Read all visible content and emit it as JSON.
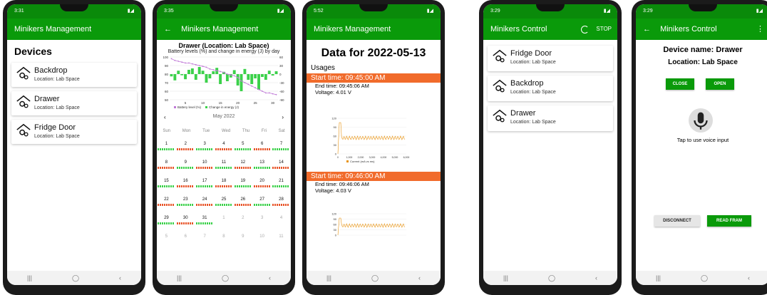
{
  "phones": {
    "p1": {
      "status": {
        "time": "3:31",
        "sys": "▮◢"
      },
      "title": "Minikers Management",
      "heading": "Devices",
      "devices": [
        {
          "name": "Backdrop",
          "location": "Location: Lab Space"
        },
        {
          "name": "Drawer",
          "location": "Location: Lab Space"
        },
        {
          "name": "Fridge Door",
          "location": "Location: Lab Space"
        }
      ]
    },
    "p2": {
      "status": {
        "time": "3:35",
        "sys": "▮◢"
      },
      "title": "Minikers Management",
      "chart_title": "Drawer (Location: Lab Space)",
      "chart_subtitle": "Battery levels (%) and change in energy (J) by day",
      "legend_battery": "Battery level (%)",
      "legend_energy": "Change in energy (J)",
      "month": "May 2022",
      "dows": [
        "Sun",
        "Mon",
        "Tue",
        "Wed",
        "Thu",
        "Fri",
        "Sat"
      ],
      "weeks": [
        [
          "1",
          "2",
          "3",
          "4",
          "5",
          "6",
          "7"
        ],
        [
          "8",
          "9",
          "10",
          "11",
          "12",
          "13",
          "14"
        ],
        [
          "15",
          "16",
          "17",
          "18",
          "19",
          "20",
          "21"
        ],
        [
          "22",
          "23",
          "24",
          "25",
          "26",
          "27",
          "28"
        ],
        [
          "29",
          "30",
          "31",
          "1",
          "2",
          "3",
          "4"
        ],
        [
          "5",
          "6",
          "7",
          "8",
          "9",
          "10",
          "11"
        ]
      ]
    },
    "p3": {
      "status": {
        "time": "5:52",
        "sys": "▮◢"
      },
      "title": "Minikers Management",
      "big": "Data for 2022-05-13",
      "usages": "Usages",
      "entries": [
        {
          "start": "Start time: 09:45:00 AM",
          "end": "End time: 09:45:06 AM",
          "voltage": "Voltage: 4.01 V"
        },
        {
          "start": "Start time: 09:46:00 AM",
          "end": "End time: 09:46:06 AM",
          "voltage": "Voltage: 4.03 V"
        }
      ],
      "mini_legend": "Current (mA vs ms)",
      "mini_xticks": [
        "0",
        "1,000",
        "2,000",
        "3,000",
        "4,000",
        "5,000",
        "6,000"
      ],
      "mini_yticks": [
        "120",
        "90",
        "60",
        "30",
        "0"
      ]
    },
    "p4": {
      "status": {
        "time": "3:29",
        "sys": "▮◢"
      },
      "title": "Minikers Control",
      "stop": "STOP",
      "devices": [
        {
          "name": "Fridge Door",
          "location": "Location: Lab Space"
        },
        {
          "name": "Backdrop",
          "location": "Location: Lab Space"
        },
        {
          "name": "Drawer",
          "location": "Location: Lab Space"
        }
      ]
    },
    "p5": {
      "status": {
        "time": "3:29",
        "sys": "▮◢"
      },
      "title": "Minikers Control",
      "device_name": "Device name: Drawer",
      "location": "Location: Lab Space",
      "close": "CLOSE",
      "open": "OPEN",
      "voice": "Tap to use voice input",
      "disconnect": "DISCONNECT",
      "read": "READ FRAM"
    }
  },
  "nav": {
    "recent": "|||",
    "home": "◯",
    "back": "‹"
  },
  "icons": {
    "device": "gear-house-icon",
    "mic": "mic-icon",
    "back": "arrow-back-icon",
    "more": "more-vert-icon"
  },
  "colors": {
    "primary": "#0a9a0a",
    "accent": "#f16b2b",
    "battery": "#c07ad7",
    "energy": "#3bd14a",
    "dot_green": "#3bd14a",
    "dot_red": "#e8552a"
  },
  "chart_data": {
    "type": "bar",
    "title": "Drawer (Location: Lab Space)",
    "subtitle": "Battery levels (%) and change in energy (J) by day",
    "x": [
      1,
      2,
      3,
      4,
      5,
      6,
      7,
      8,
      9,
      10,
      11,
      12,
      13,
      14,
      15,
      16,
      17,
      18,
      19,
      20,
      21,
      22,
      23,
      24,
      25,
      26,
      27,
      28,
      29,
      30,
      31
    ],
    "xticks": [
      5,
      10,
      15,
      20,
      25,
      30
    ],
    "series": [
      {
        "name": "Change in energy (J)",
        "values": [
          -8,
          -22,
          12,
          -4,
          -18,
          15,
          20,
          -20,
          25,
          12,
          -30,
          -15,
          10,
          22,
          -35,
          8,
          -25,
          -12,
          14,
          -40,
          -60,
          18,
          -20,
          -35,
          -15,
          -55,
          -10,
          -20,
          12,
          -5,
          10
        ]
      },
      {
        "name": "Battery level (%)",
        "values": [
          98,
          96,
          95,
          94,
          93,
          93,
          92,
          91,
          90,
          89,
          88,
          86,
          85,
          84,
          83,
          82,
          80,
          79,
          78,
          76,
          72,
          70,
          68,
          66,
          64,
          62,
          60,
          58,
          58,
          57,
          56
        ]
      }
    ],
    "ylim_left": [
      50,
      100
    ],
    "ylim_right": [
      -90,
      60
    ],
    "yticks_left": [
      100,
      90,
      80,
      70,
      60,
      50
    ],
    "yticks_right": [
      60,
      30,
      0,
      -30,
      -60,
      -90
    ],
    "grid": true,
    "legend": "bottom"
  }
}
